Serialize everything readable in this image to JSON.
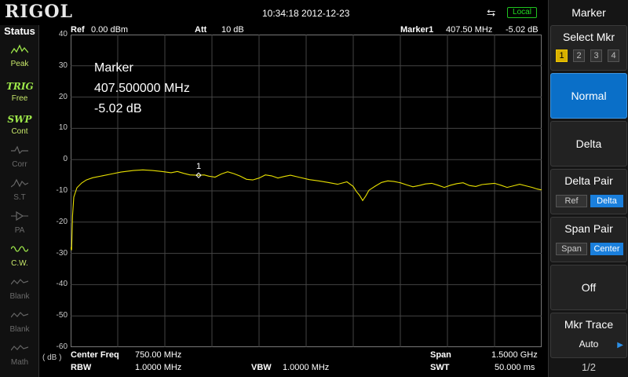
{
  "brand": "RIGOL",
  "datetime": "10:34:18 2012-12-23",
  "remote_status": "Local",
  "status_panel": {
    "title": "Status",
    "items": [
      {
        "icon": "peak-icon",
        "label": "Peak",
        "state": "on"
      },
      {
        "icon": "trig-icon",
        "icon_text": "TRIG",
        "label": "Free",
        "state": "on"
      },
      {
        "icon": "sweep-icon",
        "icon_text": "SWP",
        "label": "Cont",
        "state": "on"
      },
      {
        "icon": "corr-icon",
        "label": "Corr",
        "state": "off"
      },
      {
        "icon": "source-tracking-icon",
        "label": "S.T",
        "state": "off"
      },
      {
        "icon": "preamp-icon",
        "label": "PA",
        "state": "off"
      },
      {
        "icon": "cw-icon",
        "label": "C.W.",
        "state": "on"
      },
      {
        "icon": "blank-icon",
        "label": "Blank",
        "state": "off"
      },
      {
        "icon": "blank-icon",
        "label": "Blank",
        "state": "off"
      },
      {
        "icon": "math-icon",
        "label": "Math",
        "state": "off"
      }
    ]
  },
  "header": {
    "ref_label": "Ref",
    "ref_value": "0.00 dBm",
    "att_label": "Att",
    "att_value": "10 dB",
    "marker_label": "Marker1",
    "marker_freq": "407.50 MHz",
    "marker_level": "-5.02 dB"
  },
  "marker_readout": {
    "title": "Marker",
    "freq": "407.500000 MHz",
    "level": "-5.02 dB"
  },
  "y_axis": {
    "unit": "( dB )",
    "ticks": [
      "40",
      "30",
      "20",
      "10",
      "0",
      "-10",
      "-20",
      "-30",
      "-40",
      "-50",
      "-60"
    ]
  },
  "footer": {
    "center_freq_label": "Center Freq",
    "center_freq_value": "750.00 MHz",
    "rbw_label": "RBW",
    "rbw_value": "1.0000 MHz",
    "vbw_label": "VBW",
    "vbw_value": "1.0000 MHz",
    "span_label": "Span",
    "span_value": "1.5000 GHz",
    "swt_label": "SWT",
    "swt_value": "50.000 ms"
  },
  "menu": {
    "title": "Marker",
    "select_mkr": {
      "label": "Select Mkr",
      "options": [
        "1",
        "2",
        "3",
        "4"
      ],
      "selected": "1"
    },
    "normal": "Normal",
    "delta": "Delta",
    "delta_pair": {
      "label": "Delta Pair",
      "options": [
        "Ref",
        "Delta"
      ],
      "selected": "Delta"
    },
    "span_pair": {
      "label": "Span Pair",
      "options": [
        "Span",
        "Center"
      ],
      "selected": "Center"
    },
    "off": "Off",
    "mkr_trace": {
      "label": "Mkr Trace",
      "value": "Auto"
    },
    "page": "1/2"
  },
  "colors": {
    "trace": "#e8e000",
    "accent_blue": "#0a6fc8",
    "local_green": "#22dd22",
    "status_green": "#9ee84a"
  },
  "chart_data": {
    "type": "line",
    "xlim": [
      0,
      1500
    ],
    "ylim": [
      -60,
      40
    ],
    "marker_point": {
      "x": 407.5,
      "y": -5.02,
      "label": "1"
    },
    "series": [
      {
        "values_xy": [
          [
            0,
            -28
          ],
          [
            3,
            -29
          ],
          [
            6,
            -18
          ],
          [
            10,
            -12
          ],
          [
            20,
            -9
          ],
          [
            35,
            -7.5
          ],
          [
            50,
            -6.5
          ],
          [
            70,
            -5.8
          ],
          [
            100,
            -5.2
          ],
          [
            130,
            -4.6
          ],
          [
            160,
            -4.0
          ],
          [
            200,
            -3.5
          ],
          [
            230,
            -3.3
          ],
          [
            260,
            -3.5
          ],
          [
            290,
            -3.8
          ],
          [
            320,
            -4.2
          ],
          [
            340,
            -3.8
          ],
          [
            360,
            -4.4
          ],
          [
            380,
            -4.9
          ],
          [
            407.5,
            -5.02
          ],
          [
            425,
            -4.9
          ],
          [
            440,
            -5.3
          ],
          [
            460,
            -5.6
          ],
          [
            480,
            -4.6
          ],
          [
            500,
            -3.9
          ],
          [
            520,
            -4.5
          ],
          [
            540,
            -5.3
          ],
          [
            560,
            -6.3
          ],
          [
            580,
            -6.5
          ],
          [
            600,
            -5.9
          ],
          [
            620,
            -4.9
          ],
          [
            640,
            -5.2
          ],
          [
            660,
            -5.9
          ],
          [
            680,
            -5.4
          ],
          [
            700,
            -5.0
          ],
          [
            730,
            -5.7
          ],
          [
            760,
            -6.4
          ],
          [
            790,
            -6.8
          ],
          [
            820,
            -7.3
          ],
          [
            850,
            -7.9
          ],
          [
            880,
            -7.1
          ],
          [
            900,
            -8.6
          ],
          [
            910,
            -10.2
          ],
          [
            920,
            -11.4
          ],
          [
            930,
            -13.1
          ],
          [
            940,
            -11.6
          ],
          [
            950,
            -9.8
          ],
          [
            970,
            -8.5
          ],
          [
            990,
            -7.3
          ],
          [
            1010,
            -6.8
          ],
          [
            1030,
            -7.0
          ],
          [
            1050,
            -7.4
          ],
          [
            1070,
            -8.1
          ],
          [
            1090,
            -8.7
          ],
          [
            1110,
            -8.3
          ],
          [
            1130,
            -7.8
          ],
          [
            1150,
            -7.6
          ],
          [
            1170,
            -8.2
          ],
          [
            1190,
            -8.9
          ],
          [
            1210,
            -8.2
          ],
          [
            1230,
            -7.7
          ],
          [
            1250,
            -7.4
          ],
          [
            1270,
            -8.3
          ],
          [
            1290,
            -8.6
          ],
          [
            1310,
            -8.0
          ],
          [
            1330,
            -7.8
          ],
          [
            1350,
            -7.6
          ],
          [
            1370,
            -8.2
          ],
          [
            1390,
            -8.9
          ],
          [
            1410,
            -8.4
          ],
          [
            1430,
            -7.9
          ],
          [
            1450,
            -8.4
          ],
          [
            1470,
            -8.9
          ],
          [
            1485,
            -9.4
          ],
          [
            1500,
            -9.7
          ]
        ]
      }
    ]
  }
}
